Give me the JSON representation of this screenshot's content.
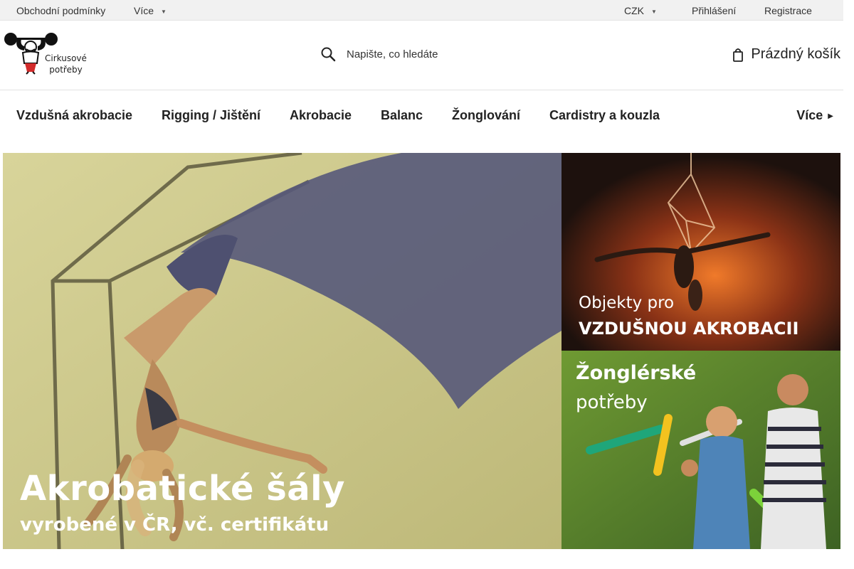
{
  "topbar": {
    "terms": "Obchodní podmínky",
    "more": "Více",
    "currency": "CZK",
    "login": "Přihlášení",
    "register": "Registrace"
  },
  "header": {
    "logo_text_line1": "Cirkusové",
    "logo_text_line2": "potřeby",
    "search_placeholder": "Napište, co hledáte",
    "cart_label": "Prázdný košík"
  },
  "nav": {
    "items": [
      {
        "label": "Vzdušná akrobacie"
      },
      {
        "label": "Rigging / Jištění"
      },
      {
        "label": "Akrobacie"
      },
      {
        "label": "Balanc"
      },
      {
        "label": "Žonglování"
      },
      {
        "label": "Cardistry a kouzla"
      }
    ],
    "more": "Více"
  },
  "banners": {
    "main": {
      "line1": "Akrobatické šály",
      "line2": "vyrobené v ČR, vč. certifikátu"
    },
    "aerial": {
      "line1": "Objekty pro",
      "line2": "VZDUŠNOU AKROBACII"
    },
    "juggle": {
      "line1": "Žonglérské",
      "line2": "potřeby"
    }
  },
  "icons": {
    "search": "search-icon",
    "cart": "cart-icon",
    "chevron": "chevron-down-icon",
    "logo": "strongman-logo"
  }
}
